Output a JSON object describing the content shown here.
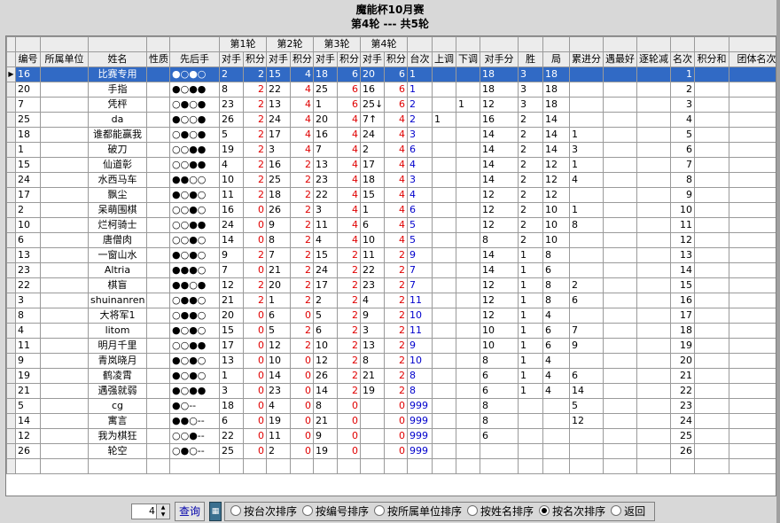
{
  "header": {
    "title": "魔能杯10月赛",
    "subtitle": "第4轮 --- 共5轮"
  },
  "round_headers": [
    "第1轮",
    "第2轮",
    "第3轮",
    "第4轮"
  ],
  "columns": [
    "编号",
    "所属单位",
    "姓名",
    "性质",
    "先后手",
    "对手",
    "积分",
    "对手",
    "积分",
    "对手",
    "积分",
    "对手",
    "积分",
    "台次",
    "上调",
    "下调",
    "对手分",
    "胜",
    "局",
    "累进分",
    "遇最好",
    "逐轮减",
    "名次",
    "积分和",
    "团体名次"
  ],
  "rows": [
    {
      "id": "16",
      "unit": "",
      "name": "比赛专用",
      "type": "",
      "seq": "●○●○",
      "r1o": "2",
      "r1s": "2",
      "r2o": "15",
      "r2s": "4",
      "r3o": "18",
      "r3s": "6",
      "r4o": "20",
      "r4s": "6",
      "table": "1",
      "up": "",
      "down": "",
      "opp": "18",
      "win": "3",
      "ju": "18",
      "acc": "",
      "best": "",
      "dec": "",
      "rank": "1",
      "sum": "",
      "team": ""
    },
    {
      "id": "20",
      "unit": "",
      "name": "手指",
      "type": "",
      "seq": "●○●●",
      "r1o": "8",
      "r1s": "2",
      "r2o": "22",
      "r2s": "4",
      "r3o": "25",
      "r3s": "6",
      "r4o": "16",
      "r4s": "6",
      "table": "1",
      "up": "",
      "down": "",
      "opp": "18",
      "win": "3",
      "ju": "18",
      "acc": "",
      "best": "",
      "dec": "",
      "rank": "2",
      "sum": "",
      "team": ""
    },
    {
      "id": "7",
      "unit": "",
      "name": "凭枰",
      "type": "",
      "seq": "○●○●",
      "r1o": "23",
      "r1s": "2",
      "r2o": "13",
      "r2s": "4",
      "r3o": "1",
      "r3s": "6",
      "r4o": "25↓",
      "r4s": "6",
      "table": "2",
      "up": "",
      "down": "1",
      "opp": "12",
      "win": "3",
      "ju": "18",
      "acc": "",
      "best": "",
      "dec": "",
      "rank": "3",
      "sum": "",
      "team": ""
    },
    {
      "id": "25",
      "unit": "",
      "name": "da",
      "type": "",
      "seq": "●○○●",
      "r1o": "26",
      "r1s": "2",
      "r2o": "24",
      "r2s": "4",
      "r3o": "20",
      "r3s": "4",
      "r4o": "7↑",
      "r4s": "4",
      "table": "2",
      "up": "1",
      "down": "",
      "opp": "16",
      "win": "2",
      "ju": "14",
      "acc": "",
      "best": "",
      "dec": "",
      "rank": "4",
      "sum": "",
      "team": ""
    },
    {
      "id": "18",
      "unit": "",
      "name": "谁都能赢我",
      "type": "",
      "seq": "○●○●",
      "r1o": "5",
      "r1s": "2",
      "r2o": "17",
      "r2s": "4",
      "r3o": "16",
      "r3s": "4",
      "r4o": "24",
      "r4s": "4",
      "table": "3",
      "up": "",
      "down": "",
      "opp": "14",
      "win": "2",
      "ju": "14",
      "acc": "1",
      "best": "",
      "dec": "",
      "rank": "5",
      "sum": "",
      "team": ""
    },
    {
      "id": "1",
      "unit": "",
      "name": "破刀",
      "type": "",
      "seq": "○○●●",
      "r1o": "19",
      "r1s": "2",
      "r2o": "3",
      "r2s": "4",
      "r3o": "7",
      "r3s": "4",
      "r4o": "2",
      "r4s": "4",
      "table": "6",
      "up": "",
      "down": "",
      "opp": "14",
      "win": "2",
      "ju": "14",
      "acc": "3",
      "best": "",
      "dec": "",
      "rank": "6",
      "sum": "",
      "team": ""
    },
    {
      "id": "15",
      "unit": "",
      "name": "仙道彰",
      "type": "",
      "seq": "○○●●",
      "r1o": "4",
      "r1s": "2",
      "r2o": "16",
      "r2s": "2",
      "r3o": "13",
      "r3s": "4",
      "r4o": "17",
      "r4s": "4",
      "table": "4",
      "up": "",
      "down": "",
      "opp": "14",
      "win": "2",
      "ju": "12",
      "acc": "1",
      "best": "",
      "dec": "",
      "rank": "7",
      "sum": "",
      "team": ""
    },
    {
      "id": "24",
      "unit": "",
      "name": "水西马车",
      "type": "",
      "seq": "●●○○",
      "r1o": "10",
      "r1s": "2",
      "r2o": "25",
      "r2s": "2",
      "r3o": "23",
      "r3s": "4",
      "r4o": "18",
      "r4s": "4",
      "table": "3",
      "up": "",
      "down": "",
      "opp": "14",
      "win": "2",
      "ju": "12",
      "acc": "4",
      "best": "",
      "dec": "",
      "rank": "8",
      "sum": "",
      "team": ""
    },
    {
      "id": "17",
      "unit": "",
      "name": "飘尘",
      "type": "",
      "seq": "●○●○",
      "r1o": "11",
      "r1s": "2",
      "r2o": "18",
      "r2s": "2",
      "r3o": "22",
      "r3s": "4",
      "r4o": "15",
      "r4s": "4",
      "table": "4",
      "up": "",
      "down": "",
      "opp": "12",
      "win": "2",
      "ju": "12",
      "acc": "",
      "best": "",
      "dec": "",
      "rank": "9",
      "sum": "",
      "team": ""
    },
    {
      "id": "2",
      "unit": "",
      "name": "呆萌围棋",
      "type": "",
      "seq": "○○●○",
      "r1o": "16",
      "r1s": "0",
      "r2o": "26",
      "r2s": "2",
      "r3o": "3",
      "r3s": "4",
      "r4o": "1",
      "r4s": "4",
      "table": "6",
      "up": "",
      "down": "",
      "opp": "12",
      "win": "2",
      "ju": "10",
      "acc": "1",
      "best": "",
      "dec": "",
      "rank": "10",
      "sum": "",
      "team": ""
    },
    {
      "id": "10",
      "unit": "",
      "name": "烂柯骑士",
      "type": "",
      "seq": "○○●●",
      "r1o": "24",
      "r1s": "0",
      "r2o": "9",
      "r2s": "2",
      "r3o": "11",
      "r3s": "4",
      "r4o": "6",
      "r4s": "4",
      "table": "5",
      "up": "",
      "down": "",
      "opp": "12",
      "win": "2",
      "ju": "10",
      "acc": "8",
      "best": "",
      "dec": "",
      "rank": "11",
      "sum": "",
      "team": ""
    },
    {
      "id": "6",
      "unit": "",
      "name": "唐僧肉",
      "type": "",
      "seq": "○○●○",
      "r1o": "14",
      "r1s": "0",
      "r2o": "8",
      "r2s": "2",
      "r3o": "4",
      "r3s": "4",
      "r4o": "10",
      "r4s": "4",
      "table": "5",
      "up": "",
      "down": "",
      "opp": "8",
      "win": "2",
      "ju": "10",
      "acc": "",
      "best": "",
      "dec": "",
      "rank": "12",
      "sum": "",
      "team": ""
    },
    {
      "id": "13",
      "unit": "",
      "name": "一窗山水",
      "type": "",
      "seq": "●○●○",
      "r1o": "9",
      "r1s": "2",
      "r2o": "7",
      "r2s": "2",
      "r3o": "15",
      "r3s": "2",
      "r4o": "11",
      "r4s": "2",
      "table": "9",
      "up": "",
      "down": "",
      "opp": "14",
      "win": "1",
      "ju": "8",
      "acc": "",
      "best": "",
      "dec": "",
      "rank": "13",
      "sum": "",
      "team": ""
    },
    {
      "id": "23",
      "unit": "",
      "name": "Altria",
      "type": "",
      "seq": "●●●○",
      "r1o": "7",
      "r1s": "0",
      "r2o": "21",
      "r2s": "2",
      "r3o": "24",
      "r3s": "2",
      "r4o": "22",
      "r4s": "2",
      "table": "7",
      "up": "",
      "down": "",
      "opp": "14",
      "win": "1",
      "ju": "6",
      "acc": "",
      "best": "",
      "dec": "",
      "rank": "14",
      "sum": "",
      "team": ""
    },
    {
      "id": "22",
      "unit": "",
      "name": "棋盲",
      "type": "",
      "seq": "●●○●",
      "r1o": "12",
      "r1s": "2",
      "r2o": "20",
      "r2s": "2",
      "r3o": "17",
      "r3s": "2",
      "r4o": "23",
      "r4s": "2",
      "table": "7",
      "up": "",
      "down": "",
      "opp": "12",
      "win": "1",
      "ju": "8",
      "acc": "2",
      "best": "",
      "dec": "",
      "rank": "15",
      "sum": "",
      "team": ""
    },
    {
      "id": "3",
      "unit": "",
      "name": "shuinanren",
      "type": "",
      "seq": "○●●○",
      "r1o": "21",
      "r1s": "2",
      "r2o": "1",
      "r2s": "2",
      "r3o": "2",
      "r3s": "2",
      "r4o": "4",
      "r4s": "2",
      "table": "11",
      "up": "",
      "down": "",
      "opp": "12",
      "win": "1",
      "ju": "8",
      "acc": "6",
      "best": "",
      "dec": "",
      "rank": "16",
      "sum": "",
      "team": ""
    },
    {
      "id": "8",
      "unit": "",
      "name": "大将军1",
      "type": "",
      "seq": "○●●○",
      "r1o": "20",
      "r1s": "0",
      "r2o": "6",
      "r2s": "0",
      "r3o": "5",
      "r3s": "2",
      "r4o": "9",
      "r4s": "2",
      "table": "10",
      "up": "",
      "down": "",
      "opp": "12",
      "win": "1",
      "ju": "4",
      "acc": "",
      "best": "",
      "dec": "",
      "rank": "17",
      "sum": "",
      "team": ""
    },
    {
      "id": "4",
      "unit": "",
      "name": "litom",
      "type": "",
      "seq": "●○●○",
      "r1o": "15",
      "r1s": "0",
      "r2o": "5",
      "r2s": "2",
      "r3o": "6",
      "r3s": "2",
      "r4o": "3",
      "r4s": "2",
      "table": "11",
      "up": "",
      "down": "",
      "opp": "10",
      "win": "1",
      "ju": "6",
      "acc": "7",
      "best": "",
      "dec": "",
      "rank": "18",
      "sum": "",
      "team": ""
    },
    {
      "id": "11",
      "unit": "",
      "name": "明月千里",
      "type": "",
      "seq": "○○●●",
      "r1o": "17",
      "r1s": "0",
      "r2o": "12",
      "r2s": "2",
      "r3o": "10",
      "r3s": "2",
      "r4o": "13",
      "r4s": "2",
      "table": "9",
      "up": "",
      "down": "",
      "opp": "10",
      "win": "1",
      "ju": "6",
      "acc": "9",
      "best": "",
      "dec": "",
      "rank": "19",
      "sum": "",
      "team": ""
    },
    {
      "id": "9",
      "unit": "",
      "name": "青岚晓月",
      "type": "",
      "seq": "●○●○",
      "r1o": "13",
      "r1s": "0",
      "r2o": "10",
      "r2s": "0",
      "r3o": "12",
      "r3s": "2",
      "r4o": "8",
      "r4s": "2",
      "table": "10",
      "up": "",
      "down": "",
      "opp": "8",
      "win": "1",
      "ju": "4",
      "acc": "",
      "best": "",
      "dec": "",
      "rank": "20",
      "sum": "",
      "team": ""
    },
    {
      "id": "19",
      "unit": "",
      "name": "鹤凌霄",
      "type": "",
      "seq": "●○●○",
      "r1o": "1",
      "r1s": "0",
      "r2o": "14",
      "r2s": "0",
      "r3o": "26",
      "r3s": "2",
      "r4o": "21",
      "r4s": "2",
      "table": "8",
      "up": "",
      "down": "",
      "opp": "6",
      "win": "1",
      "ju": "4",
      "acc": "6",
      "best": "",
      "dec": "",
      "rank": "21",
      "sum": "",
      "team": ""
    },
    {
      "id": "21",
      "unit": "",
      "name": "遇强就弱",
      "type": "",
      "seq": "●○●●",
      "r1o": "3",
      "r1s": "0",
      "r2o": "23",
      "r2s": "0",
      "r3o": "14",
      "r3s": "2",
      "r4o": "19",
      "r4s": "2",
      "table": "8",
      "up": "",
      "down": "",
      "opp": "6",
      "win": "1",
      "ju": "4",
      "acc": "14",
      "best": "",
      "dec": "",
      "rank": "22",
      "sum": "",
      "team": ""
    },
    {
      "id": "5",
      "unit": "",
      "name": "cg",
      "type": "",
      "seq": "●○--",
      "r1o": "18",
      "r1s": "0",
      "r2o": "4",
      "r2s": "0",
      "r3o": "8",
      "r3s": "0",
      "r4o": "",
      "r4s": "0",
      "table": "999",
      "up": "",
      "down": "",
      "opp": "8",
      "win": "",
      "ju": "",
      "acc": "5",
      "best": "",
      "dec": "",
      "rank": "23",
      "sum": "",
      "team": ""
    },
    {
      "id": "14",
      "unit": "",
      "name": "寓言",
      "type": "",
      "seq": "●●○--",
      "r1o": "6",
      "r1s": "0",
      "r2o": "19",
      "r2s": "0",
      "r3o": "21",
      "r3s": "0",
      "r4o": "",
      "r4s": "0",
      "table": "999",
      "up": "",
      "down": "",
      "opp": "8",
      "win": "",
      "ju": "",
      "acc": "12",
      "best": "",
      "dec": "",
      "rank": "24",
      "sum": "",
      "team": ""
    },
    {
      "id": "12",
      "unit": "",
      "name": "我为棋狂",
      "type": "",
      "seq": "○○●--",
      "r1o": "22",
      "r1s": "0",
      "r2o": "11",
      "r2s": "0",
      "r3o": "9",
      "r3s": "0",
      "r4o": "",
      "r4s": "0",
      "table": "999",
      "up": "",
      "down": "",
      "opp": "6",
      "win": "",
      "ju": "",
      "acc": "",
      "best": "",
      "dec": "",
      "rank": "25",
      "sum": "",
      "team": ""
    },
    {
      "id": "26",
      "unit": "",
      "name": "轮空",
      "type": "",
      "seq": "○●○--",
      "r1o": "25",
      "r1s": "0",
      "r2o": "2",
      "r2s": "0",
      "r3o": "19",
      "r3s": "0",
      "r4o": "",
      "r4s": "0",
      "table": "999",
      "up": "",
      "down": "",
      "opp": "",
      "win": "",
      "ju": "",
      "acc": "",
      "best": "",
      "dec": "",
      "rank": "26",
      "sum": "",
      "team": ""
    }
  ],
  "controls": {
    "spin_value": "4",
    "query_label": "查询",
    "sorts": [
      "按台次排序",
      "按编号排序",
      "按所属单位排序",
      "按姓名排序",
      "按名次排序",
      "返回"
    ],
    "selected_sort": 4
  }
}
